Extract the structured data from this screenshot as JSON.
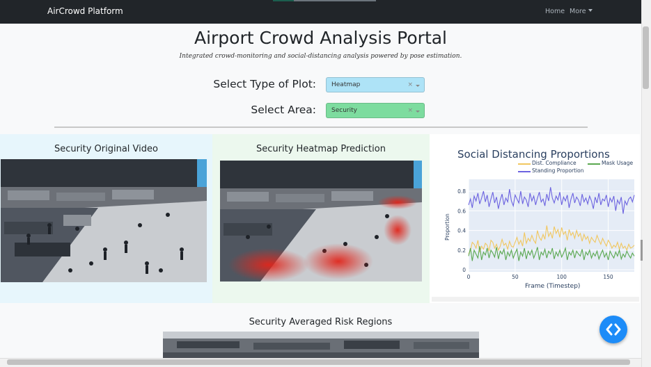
{
  "navbar": {
    "brand": "AirCrowd Platform",
    "home": "Home",
    "more": "More"
  },
  "header": {
    "title": "Airport Crowd Analysis Portal",
    "subtitle": "Integrated crowd-monitoring and social-distancing analysis powered by pose estimation."
  },
  "controls": {
    "plot_type_label": "Select Type of Plot:",
    "plot_type_value": "Heatmap",
    "plot_type_color": "#aee3f7",
    "area_label": "Select Area:",
    "area_value": "Security",
    "area_color": "#7ddc9f",
    "clear_glyph": "×"
  },
  "panels": {
    "original_title": "Security Original Video",
    "heatmap_title": "Security Heatmap Prediction",
    "averaged_title": "Security Averaged Risk Regions"
  },
  "chart_data": {
    "type": "line",
    "title": "Social Distancing Proportions",
    "xlabel": "Frame (Timestep)",
    "ylabel": "Proportion",
    "xlim": [
      0,
      178
    ],
    "ylim": [
      -0.02,
      0.92
    ],
    "x_ticks": [
      0,
      50,
      100,
      150
    ],
    "y_ticks": [
      0,
      0.2,
      0.4,
      0.6,
      0.8
    ],
    "legend_position": "top-right",
    "series": [
      {
        "name": "Dist. Compliance",
        "color": "#f1c75f",
        "start": 0,
        "step": 2,
        "values": [
          0.16,
          0.2,
          0.28,
          0.26,
          0.22,
          0.3,
          0.18,
          0.24,
          0.21,
          0.27,
          0.25,
          0.19,
          0.3,
          0.28,
          0.22,
          0.26,
          0.2,
          0.24,
          0.31,
          0.25,
          0.27,
          0.21,
          0.29,
          0.24,
          0.23,
          0.28,
          0.33,
          0.26,
          0.3,
          0.24,
          0.38,
          0.27,
          0.32,
          0.29,
          0.35,
          0.3,
          0.27,
          0.4,
          0.33,
          0.3,
          0.36,
          0.31,
          0.45,
          0.34,
          0.38,
          0.32,
          0.44,
          0.37,
          0.41,
          0.33,
          0.43,
          0.36,
          0.39,
          0.3,
          0.41,
          0.35,
          0.38,
          0.32,
          0.4,
          0.34,
          0.37,
          0.29,
          0.36,
          0.31,
          0.34,
          0.27,
          0.33,
          0.3,
          0.28,
          0.35,
          0.3,
          0.26,
          0.32,
          0.28,
          0.24,
          0.3,
          0.27,
          0.22,
          0.25,
          0.23,
          0.28,
          0.21,
          0.27,
          0.22,
          0.24,
          0.2,
          0.26,
          0.22,
          0.23,
          0.25
        ]
      },
      {
        "name": "Mask Usage",
        "color": "#5aa84f",
        "start": 0,
        "step": 2,
        "values": [
          0.14,
          0.22,
          0.09,
          0.2,
          0.16,
          0.12,
          0.24,
          0.1,
          0.18,
          0.15,
          0.22,
          0.12,
          0.2,
          0.17,
          0.13,
          0.23,
          0.11,
          0.19,
          0.16,
          0.21,
          0.1,
          0.18,
          0.14,
          0.2,
          0.12,
          0.17,
          0.21,
          0.09,
          0.18,
          0.14,
          0.22,
          0.11,
          0.19,
          0.15,
          0.2,
          0.12,
          0.17,
          0.23,
          0.1,
          0.18,
          0.15,
          0.21,
          0.12,
          0.19,
          0.16,
          0.22,
          0.11,
          0.18,
          0.14,
          0.2,
          0.13,
          0.17,
          0.22,
          0.1,
          0.18,
          0.15,
          0.2,
          0.12,
          0.19,
          0.16,
          0.14,
          0.21,
          0.1,
          0.18,
          0.15,
          0.2,
          0.12,
          0.17,
          0.14,
          0.19,
          0.11,
          0.16,
          0.2,
          0.13,
          0.17,
          0.1,
          0.19,
          0.15,
          0.12,
          0.18,
          0.14,
          0.2,
          0.11,
          0.16,
          0.13,
          0.19,
          0.15,
          0.12,
          0.17,
          0.14
        ]
      },
      {
        "name": "Standing Proportion",
        "color": "#6c63e0",
        "start": 0,
        "step": 2,
        "values": [
          0.66,
          0.72,
          0.63,
          0.75,
          0.7,
          0.78,
          0.67,
          0.73,
          0.8,
          0.69,
          0.76,
          0.64,
          0.72,
          0.79,
          0.68,
          0.74,
          0.62,
          0.71,
          0.77,
          0.66,
          0.73,
          0.69,
          0.82,
          0.7,
          0.65,
          0.76,
          0.72,
          0.68,
          0.8,
          0.67,
          0.74,
          0.71,
          0.64,
          0.78,
          0.7,
          0.75,
          0.66,
          0.73,
          0.79,
          0.69,
          0.72,
          0.65,
          0.77,
          0.7,
          0.84,
          0.73,
          0.68,
          0.75,
          0.71,
          0.79,
          0.66,
          0.74,
          0.7,
          0.76,
          0.63,
          0.72,
          0.78,
          0.68,
          0.74,
          0.71,
          0.65,
          0.77,
          0.69,
          0.73,
          0.67,
          0.75,
          0.7,
          0.62,
          0.74,
          0.68,
          0.78,
          0.66,
          0.72,
          0.7,
          0.76,
          0.64,
          0.73,
          0.69,
          0.75,
          0.6,
          0.71,
          0.67,
          0.74,
          0.57,
          0.7,
          0.66,
          0.72,
          0.74,
          0.69,
          0.76
        ]
      }
    ]
  }
}
